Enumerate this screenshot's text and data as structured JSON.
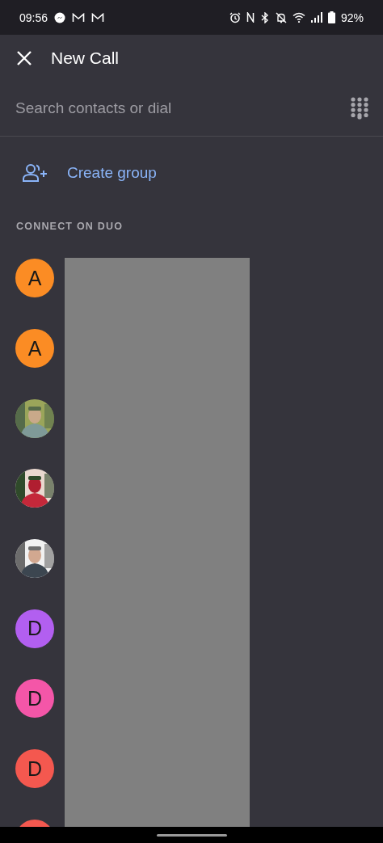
{
  "status_bar": {
    "time": "09:56",
    "battery": "92%"
  },
  "header": {
    "title": "New Call"
  },
  "search": {
    "placeholder": "Search contacts or dial"
  },
  "create_group": {
    "label": "Create group"
  },
  "section": {
    "title": "CONNECT ON DUO"
  },
  "contacts": [
    {
      "kind": "letter",
      "initial": "A",
      "color": "#fb8c24"
    },
    {
      "kind": "letter",
      "initial": "A",
      "color": "#fb8c24"
    },
    {
      "kind": "picture"
    },
    {
      "kind": "picture"
    },
    {
      "kind": "picture"
    },
    {
      "kind": "letter",
      "initial": "D",
      "color": "#b25ff0"
    },
    {
      "kind": "letter",
      "initial": "D",
      "color": "#f456a8"
    },
    {
      "kind": "letter",
      "initial": "D",
      "color": "#f4584f"
    },
    {
      "kind": "letter",
      "color": "#f4584f"
    }
  ]
}
